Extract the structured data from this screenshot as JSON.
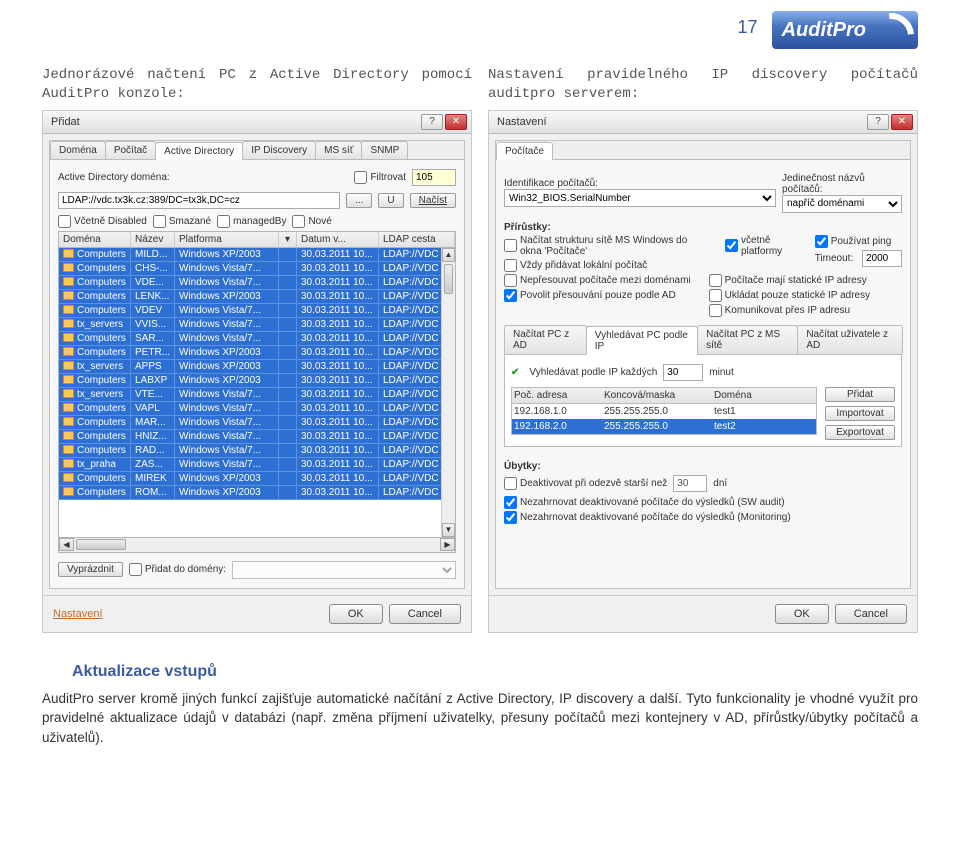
{
  "page_number": "17",
  "brand": "AuditPro",
  "heading_left": "Jednorázové načtení PC z Active Directory pomocí AuditPro konzole:",
  "heading_right": "Nastavení pravidelného IP discovery počítačů auditpro serverem:",
  "left": {
    "title": "Přidat",
    "tabs": [
      "Doména",
      "Počítač",
      "Active Directory",
      "IP Discovery",
      "MS síť",
      "SNMP"
    ],
    "active_tab": 2,
    "ad_domain_label": "Active Directory doména:",
    "filter_label": "Filtrovat",
    "count": "105",
    "ad_domain_value": "LDAP://vdc.tx3k.cz:389/DC=tx3k,DC=cz",
    "btn_browse": "...",
    "btn_u": "U",
    "btn_load": "Načíst",
    "chk_disabled": "Včetně Disabled",
    "chk_deleted": "Smazané",
    "chk_managedby": "managedBy",
    "chk_nove": "Nové",
    "cols": [
      "Doména",
      "Název",
      "Platforma",
      "Datum v...",
      "LDAP cesta"
    ],
    "col_header_dropdown": "▾",
    "rows": [
      {
        "d": "Computers",
        "n": "MILD...",
        "p": "Windows XP/2003",
        "dt": "30.03.2011 10...",
        "l": "LDAP://VDC"
      },
      {
        "d": "Computers",
        "n": "CHS-...",
        "p": "Windows Vista/7...",
        "dt": "30.03.2011 10...",
        "l": "LDAP://VDC"
      },
      {
        "d": "Computers",
        "n": "VDE...",
        "p": "Windows Vista/7...",
        "dt": "30.03.2011 10...",
        "l": "LDAP://VDC"
      },
      {
        "d": "Computers",
        "n": "LENK...",
        "p": "Windows XP/2003",
        "dt": "30.03.2011 10...",
        "l": "LDAP://VDC"
      },
      {
        "d": "Computers",
        "n": "VDEV",
        "p": "Windows Vista/7...",
        "dt": "30.03.2011 10...",
        "l": "LDAP://VDC"
      },
      {
        "d": "tx_servers",
        "n": "VVIS...",
        "p": "Windows Vista/7...",
        "dt": "30.03.2011 10...",
        "l": "LDAP://VDC"
      },
      {
        "d": "Computers",
        "n": "SAR...",
        "p": "Windows Vista/7...",
        "dt": "30.03.2011 10...",
        "l": "LDAP://VDC"
      },
      {
        "d": "Computers",
        "n": "PETR...",
        "p": "Windows XP/2003",
        "dt": "30.03.2011 10...",
        "l": "LDAP://VDC"
      },
      {
        "d": "tx_servers",
        "n": "APPS",
        "p": "Windows XP/2003",
        "dt": "30.03.2011 10...",
        "l": "LDAP://VDC"
      },
      {
        "d": "Computers",
        "n": "LABXP",
        "p": "Windows XP/2003",
        "dt": "30.03.2011 10...",
        "l": "LDAP://VDC"
      },
      {
        "d": "tx_servers",
        "n": "VTE...",
        "p": "Windows Vista/7...",
        "dt": "30.03.2011 10...",
        "l": "LDAP://VDC"
      },
      {
        "d": "Computers",
        "n": "VAPL",
        "p": "Windows Vista/7...",
        "dt": "30.03.2011 10...",
        "l": "LDAP://VDC"
      },
      {
        "d": "Computers",
        "n": "MAR...",
        "p": "Windows Vista/7...",
        "dt": "30.03.2011 10...",
        "l": "LDAP://VDC"
      },
      {
        "d": "Computers",
        "n": "HNIZ...",
        "p": "Windows Vista/7...",
        "dt": "30.03.2011 10...",
        "l": "LDAP://VDC"
      },
      {
        "d": "Computers",
        "n": "RAD...",
        "p": "Windows Vista/7...",
        "dt": "30.03.2011 10...",
        "l": "LDAP://VDC"
      },
      {
        "d": "tx_praha",
        "n": "ZAS...",
        "p": "Windows Vista/7...",
        "dt": "30.03.2011 10...",
        "l": "LDAP://VDC"
      },
      {
        "d": "Computers",
        "n": "MIREK",
        "p": "Windows XP/2003",
        "dt": "30.03.2011 10...",
        "l": "LDAP://VDC"
      },
      {
        "d": "Computers",
        "n": "ROM...",
        "p": "Windows XP/2003",
        "dt": "30.03.2011 10...",
        "l": "LDAP://VDC"
      }
    ],
    "btn_empty": "Vyprázdnit",
    "lbl_add_to_domain": "Přidat do domény:",
    "link_settings": "Nastavení",
    "ok": "OK",
    "cancel": "Cancel"
  },
  "right": {
    "title": "Nastavení",
    "tabs": [
      "Počítače"
    ],
    "lbl_identify": "Identifikace počítačů:",
    "identify_value": "Win32_BIOS.SerialNumber",
    "lbl_unique": "Jedinečnost názvů počítačů:",
    "unique_value": "napříč doménami",
    "lbl_prirustky": "Přírůstky:",
    "chk_struct": "Načítat strukturu sítě MS Windows do okna 'Počítače'",
    "chk_local": "Vždy přidávat lokální počítač",
    "chk_platforms": "včetně platformy",
    "chk_ping": "Používat ping",
    "lbl_timeout": "Timeout:",
    "timeout_value": "2000",
    "chk_noswap": "Nepřesouvat počítače mezi doménami",
    "chk_allowmove": "Povolit přesouvání pouze podle AD",
    "chk_staticip": "Počítače mají statické IP adresy",
    "chk_savestatic": "Ukládat pouze statické IP adresy",
    "chk_commip": "Komunikovat přes IP adresu",
    "subtabs": [
      "Načítat PC z AD",
      "Vyhledávat PC podle IP",
      "Načítat PC z MS sítě",
      "Načítat uživatele z AD"
    ],
    "subtab_active": 1,
    "chk_searchip": "Vyhledávat podle IP každých",
    "searchip_value": "30",
    "lbl_minut": "minut",
    "range_cols": [
      "Poč. adresa",
      "Koncová/maska",
      "Doména"
    ],
    "ranges": [
      {
        "a": "192.168.1.0",
        "m": "255.255.255.0",
        "d": "test1"
      },
      {
        "a": "192.168.2.0",
        "m": "255.255.255.0",
        "d": "test2"
      }
    ],
    "btn_pridat": "Přidat",
    "btn_import": "Importovat",
    "btn_export": "Exportovat",
    "lbl_ubytky": "Úbytky:",
    "chk_deact": "Deaktivovat při odezvě starší než",
    "deact_value": "30",
    "lbl_dni": "dní",
    "chk_nez_sw": "Nezahrnovat deaktivované počítače do výsledků (SW audit)",
    "chk_nez_mon": "Nezahrnovat deaktivované počítače do výsledků (Monitoring)",
    "ok": "OK",
    "cancel": "Cancel"
  },
  "article": {
    "title": "Aktualizace vstupů",
    "body": "AuditPro server kromě jiných funkcí zajišťuje automatické načítání z Active Directory, IP discovery a další. Tyto funkcionality je vhodné využít pro pravidelné aktualizace údajů v databázi (např. změna příjmení uživatelky, přesuny počítačů mezi kontejnery v AD, přírůstky/úbytky počítačů a uživatelů)."
  }
}
